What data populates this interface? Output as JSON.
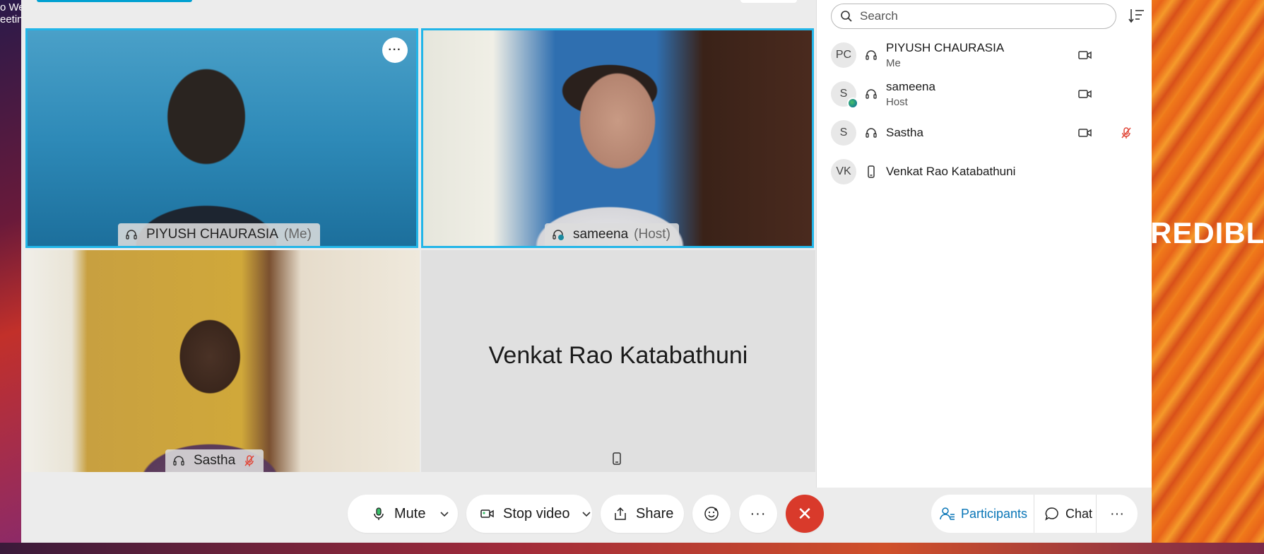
{
  "desktop": {
    "left_text_line1": "o We",
    "left_text_line2": "eeting",
    "right_text": "REDIBLE"
  },
  "tiles": {
    "piyush": {
      "name": "PIYUSH CHAURASIA",
      "role": "(Me)",
      "more_label": "···"
    },
    "sameena": {
      "name": "sameena",
      "role": "(Host)"
    },
    "sastha": {
      "name": "Sastha"
    },
    "venkat": {
      "name": "Venkat Rao Katabathuni"
    }
  },
  "panel": {
    "search_placeholder": "Search",
    "participants": [
      {
        "initials": "PC",
        "name": "PIYUSH CHAURASIA",
        "sub": "Me",
        "audio": "headset",
        "video": true,
        "muted": false
      },
      {
        "initials": "S",
        "name": "sameena",
        "sub": "Host",
        "audio": "headset",
        "video": true,
        "muted": false
      },
      {
        "initials": "S",
        "name": "Sastha",
        "sub": "",
        "audio": "headset",
        "video": true,
        "muted": true
      },
      {
        "initials": "VK",
        "name": "Venkat Rao Katabathuni",
        "sub": "",
        "audio": "phone",
        "video": false,
        "muted": false
      }
    ]
  },
  "controls": {
    "mute": "Mute",
    "stop_video": "Stop video",
    "share": "Share",
    "more": "···",
    "end": "✕",
    "participants": "Participants",
    "chat": "Chat",
    "panel_more": "···"
  },
  "colors": {
    "accent": "#0a76b7",
    "active_border": "#22b5e8",
    "end_button": "#d93a2b",
    "mute_icon": "#e0483a"
  }
}
